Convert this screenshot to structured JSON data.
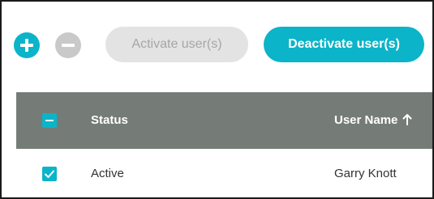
{
  "toolbar": {
    "add_icon": "plus-circle-icon",
    "remove_icon": "minus-circle-icon",
    "activate_label": "Activate user(s)",
    "deactivate_label": "Deactivate user(s)"
  },
  "table": {
    "header": {
      "select_all_state": "indeterminate",
      "columns": [
        "Status",
        "User Name"
      ],
      "sort_column": "User Name",
      "sort_direction": "ascending",
      "sort_icon": "arrow-up-icon"
    },
    "rows": [
      {
        "selected": true,
        "status": "Active",
        "user_name": "Garry Knott"
      }
    ]
  },
  "colors": {
    "accent": "#0bb4c9",
    "disabled_bg": "#e3e3e3",
    "disabled_text": "#a6a6a6",
    "header_bg": "#757c77"
  }
}
